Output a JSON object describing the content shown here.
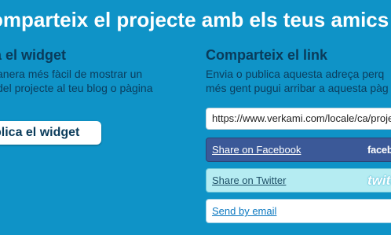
{
  "headline": "omparteix el projecte amb els teus amics",
  "widget": {
    "title": "a el widget",
    "desc_line1": "anera més fàcil de mostrar un",
    "desc_line2": "del projecte al teu blog o pàgina",
    "button_label": "blica el widget"
  },
  "share": {
    "title": "Comparteix el link",
    "desc_line1": "Envia o publica aquesta adreça perq",
    "desc_line2": "més gent pugui arribar a aquesta pàg",
    "url_value": "https://www.verkami.com/locale/ca/projects/",
    "facebook": {
      "label": "Share on Facebook",
      "logo_text": "facebook",
      "icon": "facebook-logo-icon"
    },
    "twitter": {
      "label": "Share on Twitter",
      "logo_text": "twitter",
      "icon": "twitter-logo-icon"
    },
    "email": {
      "label": "Send by email"
    }
  },
  "colors": {
    "background": "#0f93c7",
    "headline": "#ffffff",
    "heading_dark": "#0a3b5a",
    "facebook_blue": "#3b5998",
    "twitter_light": "#b5ecf2",
    "email_link": "#0b78c0"
  }
}
